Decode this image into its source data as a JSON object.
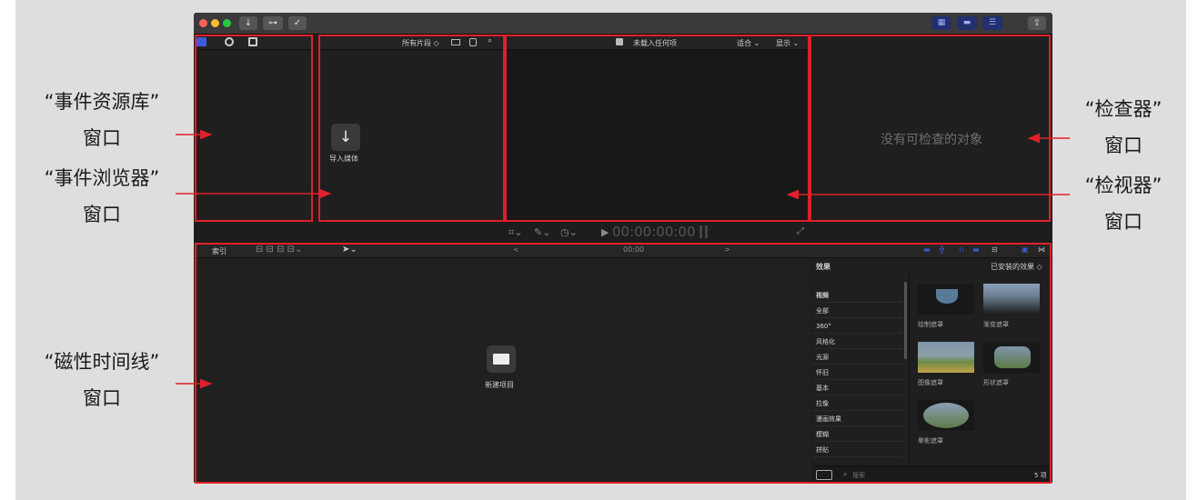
{
  "annotations": {
    "event_library": [
      "“事件资源库”",
      "窗口"
    ],
    "event_browser": [
      "“事件浏览器”",
      "窗口"
    ],
    "inspector": [
      "“检查器”",
      "窗口"
    ],
    "viewer": [
      "“检视器”",
      "窗口"
    ],
    "timeline": [
      "“磁性时间线”",
      "窗口"
    ]
  },
  "titlebar": {
    "import_icon": "↓",
    "key_icon": "⊶",
    "check_icon": "✓",
    "share_icon": "⇪"
  },
  "library_tabs": [
    "library-tab-icon",
    "photos-tab-icon",
    "titles-tab-icon"
  ],
  "browser": {
    "filter": "所有片段 ◇",
    "import_label": "导入媒体",
    "import_icon": "↓"
  },
  "viewer": {
    "title": "未载入任何项",
    "fit": "适合 ⌄",
    "display": "显示 ⌄",
    "timecode": "00:00:00:00"
  },
  "inspector": {
    "empty": "没有可检查的对象"
  },
  "timeline": {
    "index": "索引",
    "nav_prev": "<",
    "nav_time": "00:00",
    "nav_next": ">",
    "new_project": "新建项目"
  },
  "effects": {
    "title": "效果",
    "installed": "已安装的效果 ◇",
    "categories": [
      "视频",
      "全部",
      "360°",
      "风格化",
      "光源",
      "怀旧",
      "基本",
      "拉像",
      "漫画效果",
      "模糊",
      "拼贴"
    ],
    "items": [
      "绘制遮罩",
      "渐变遮罩",
      "图像遮罩",
      "形状遮罩",
      "晕影遮罩"
    ],
    "search_placeholder": "搜索",
    "count": "5 项"
  },
  "colors": {
    "highlight": "#e0202a",
    "accent": "#3d5bd9"
  }
}
